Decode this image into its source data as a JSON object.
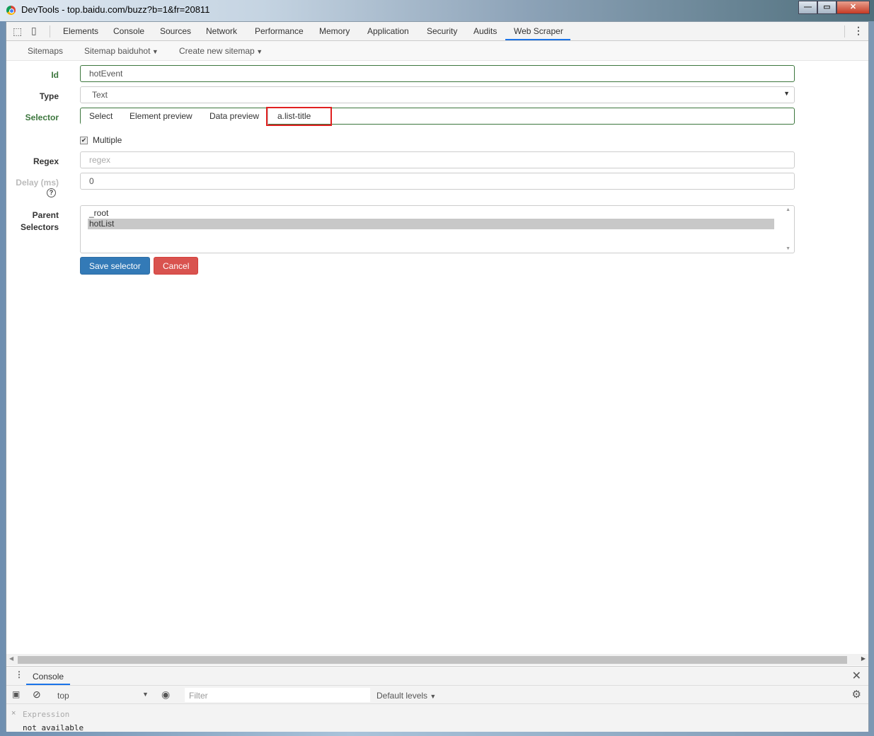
{
  "window": {
    "title": "DevTools - top.baidu.com/buzz?b=1&fr=20811",
    "minimize": "—",
    "maximize": "▭",
    "close": "✕"
  },
  "devtools": {
    "tabs": [
      "Elements",
      "Console",
      "Sources",
      "Network",
      "Performance",
      "Memory",
      "Application",
      "Security",
      "Audits",
      "Web Scraper"
    ],
    "active_tab": "Web Scraper",
    "icons": [
      "inspect-element-icon",
      "device-toolbar-icon",
      "more-options-icon"
    ]
  },
  "subnav": {
    "sitemaps": "Sitemaps",
    "sitemap": "Sitemap baiduhot",
    "create": "Create new sitemap"
  },
  "form": {
    "id_label": "Id",
    "id_value": "hotEvent",
    "type_label": "Type",
    "type_value": "Text",
    "selector_label": "Selector",
    "select_btn": "Select",
    "element_preview_btn": "Element preview",
    "data_preview_btn": "Data preview",
    "selector_value": "a.list-title",
    "multiple_label": "Multiple",
    "multiple_checked": true,
    "regex_label": "Regex",
    "regex_placeholder": "regex",
    "delay_label": "Delay (ms)",
    "delay_value": "0",
    "parent_label_1": "Parent",
    "parent_label_2": "Selectors",
    "parent_options": [
      "_root",
      "hotList"
    ],
    "parent_selected": "hotList",
    "save": "Save selector",
    "cancel": "Cancel"
  },
  "console": {
    "tab": "Console",
    "context": "top",
    "filter_placeholder": "Filter",
    "levels": "Default levels",
    "expression": "Expression",
    "expression_value": "not available"
  },
  "colors": {
    "primary": "#337ab7",
    "danger": "#d9534f",
    "success_label": "#3c763d",
    "highlight": "#e02020"
  }
}
